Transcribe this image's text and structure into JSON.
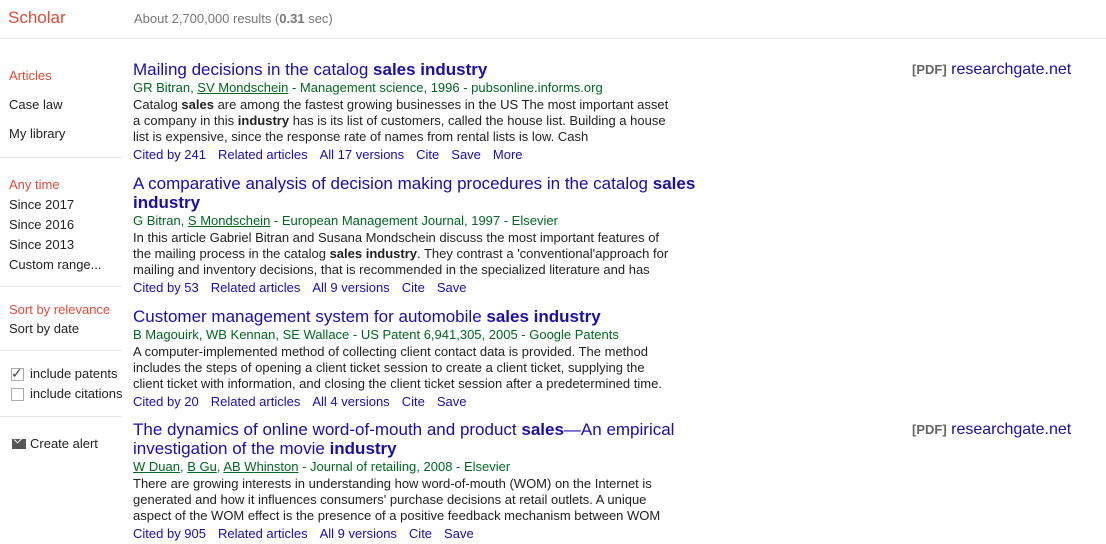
{
  "header": {
    "brand": "Scholar",
    "stats_prefix": "About 2,700,000 results (",
    "stats_time": "0.31",
    "stats_suffix": " sec)"
  },
  "sidebar": {
    "types": [
      "Articles",
      "Case law",
      "My library"
    ],
    "times": [
      "Any time",
      "Since 2017",
      "Since 2016",
      "Since 2013",
      "Custom range..."
    ],
    "sorts": [
      "Sort by relevance",
      "Sort by date"
    ],
    "include_patents": "include patents",
    "include_citations": "include citations",
    "create_alert": "Create alert"
  },
  "results": [
    {
      "title_html": "Mailing decisions in the catalog <b>sales industry</b>",
      "authors_html": "GR Bitran, <span class=\"au\">SV Mondschein</span> - Management science, 1996 - pubsonline.informs.org",
      "snippet_html": "Catalog <b>sales</b> are among the fastest growing businesses in the US The most important asset<br>a company in this <b>industry</b> has is its list of customers, called the house list. Building a house<br>list is expensive, since the response rate of names from rental lists is low. Cash",
      "links": [
        "Cited by 241",
        "Related articles",
        "All 17 versions",
        "Cite",
        "Save",
        "More"
      ],
      "pdf_tag": "[PDF]",
      "pdf_source": "researchgate.net"
    },
    {
      "title_html": "A comparative analysis of decision making procedures in the catalog <b>sales</b><br><b>industry</b>",
      "authors_html": "G Bitran, <span class=\"au\">S Mondschein</span> - European Management Journal, 1997 - Elsevier",
      "snippet_html": "In this article Gabriel Bitran and Susana Mondschein discuss the most important features of<br>the mailing process in the catalog <b>sales industry</b>. They contrast a 'conventional'approach for<br>mailing and inventory decisions, that is recommended in the specialized literature and has",
      "links": [
        "Cited by 53",
        "Related articles",
        "All 9 versions",
        "Cite",
        "Save"
      ]
    },
    {
      "title_html": "Customer management system for automobile <b>sales industry</b>",
      "authors_html": "B Magouirk, WB Kennan, SE Wallace - US Patent 6,941,305, 2005 - Google Patents",
      "snippet_html": "A computer-implemented method of collecting client contact data is provided. The method<br>includes the steps of opening a client ticket session to create a client ticket, supplying the<br>client ticket with information, and closing the client ticket session after a predetermined time.",
      "links": [
        "Cited by 20",
        "Related articles",
        "All 4 versions",
        "Cite",
        "Save"
      ]
    },
    {
      "title_html": "The dynamics of online word-of-mouth and product <b>sales</b>—An empirical<br>investigation of the movie <b>industry</b>",
      "authors_html": "<span class=\"au\">W Duan</span>, <span class=\"au\">B Gu</span>, <span class=\"au\">AB Whinston</span> - Journal of retailing, 2008 - Elsevier",
      "snippet_html": "There are growing interests in understanding how word-of-mouth (WOM) on the Internet is<br>generated and how it influences consumers' purchase decisions at retail outlets. A unique<br>aspect of the WOM effect is the presence of a positive feedback mechanism between WOM",
      "links": [
        "Cited by 905",
        "Related articles",
        "All 9 versions",
        "Cite",
        "Save"
      ],
      "pdf_tag": "[PDF]",
      "pdf_source": "researchgate.net"
    }
  ],
  "colors": {
    "brand": "#dd4b39",
    "link": "#1a0dab",
    "author": "#006621"
  }
}
